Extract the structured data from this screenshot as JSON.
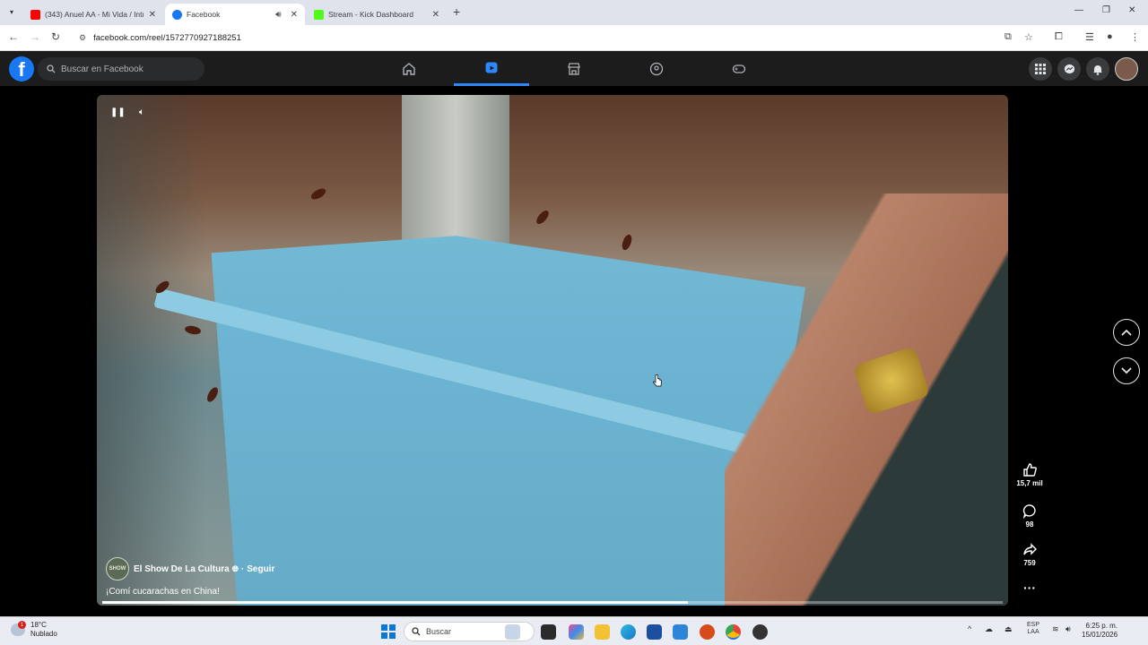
{
  "browser": {
    "tabs": [
      {
        "title": "(343) Anuel AA - Mi Vida / Intro",
        "favicon_color": "#ff0000",
        "active": false
      },
      {
        "title": "Facebook",
        "favicon_color": "#1877f2",
        "active": true
      },
      {
        "title": "Stream - Kick Dashboard",
        "favicon_color": "#53fc18",
        "active": false
      }
    ],
    "url": "facebook.com/reel/1572770927188251",
    "new_tab": "+"
  },
  "facebook": {
    "logo": "f",
    "search_placeholder": "Buscar en Facebook",
    "nav": [
      "home-icon",
      "reels-icon",
      "marketplace-icon",
      "groups-icon",
      "gaming-icon"
    ],
    "active_nav": "reels-icon"
  },
  "reel": {
    "channel": "El Show De La Cultura",
    "channel_avatar_text": "SHOW",
    "follow": "Seguir",
    "separator": "·",
    "caption": "¡Comí cucarachas en China!",
    "likes": "15,7 mil",
    "comments": "98",
    "shares": "759",
    "progress": 0.65
  },
  "taskbar": {
    "weather_temp": "18°C",
    "weather_desc": "Nublado",
    "weather_badge": "1",
    "search_label": "Buscar",
    "lang_1": "ESP",
    "lang_2": "LAA",
    "time": "6:25 p. m.",
    "date": "15/01/2026"
  },
  "colors": {
    "fb_blue": "#1877f2",
    "fb_bar": "#1c1c1d",
    "reel_active": "#2d88ff"
  }
}
